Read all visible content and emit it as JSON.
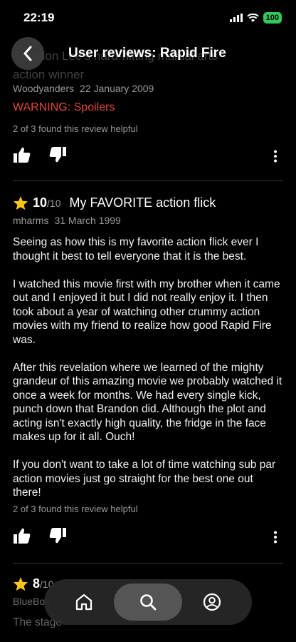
{
  "status": {
    "time": "22:19",
    "battery": "100"
  },
  "header": {
    "title": "User reviews: Rapid Fire"
  },
  "review1": {
    "title_line1": "Brandon Lee's hard-hitting martial arts",
    "title_line2": "action winner",
    "author": "Woodyanders",
    "date": "22 January 2009",
    "warning": "WARNING: Spoilers",
    "helpful": "2 of 3 found this review helpful"
  },
  "review2": {
    "rating": "10",
    "rating_max": "/10",
    "title": "My FAVORITE action flick",
    "author": "mharms",
    "date": "31 March 1999",
    "paragraphs": [
      "Seeing as how this is my favorite action flick ever I thought it best to tell everyone that it is the best.",
      "I watched this movie first with my brother when it came out and I enjoyed it but I did not really enjoy it. I then took about a year of watching other crummy action movies with my friend to realize how good Rapid Fire was.",
      "After this revelation where we learned of the mighty grandeur of this amazing movie we probably watched it once a week for months.  We had every single kick, punch down that Brandon did. Although the plot and acting isn't exactly high quality, the fridge in the face makes up for it all. Ouch!",
      "If you don't want to take a lot of time watching sub par action movies just go straight for the best one out there!"
    ],
    "helpful": "2 of 3 found this review helpful"
  },
  "review3": {
    "rating": "8",
    "rating_max": "/10",
    "author": "BlueBox",
    "body_start": "The stage"
  },
  "icons": {
    "star_color": "#f5c518",
    "accent": "#f5c518",
    "warning_color": "#e0473a"
  }
}
